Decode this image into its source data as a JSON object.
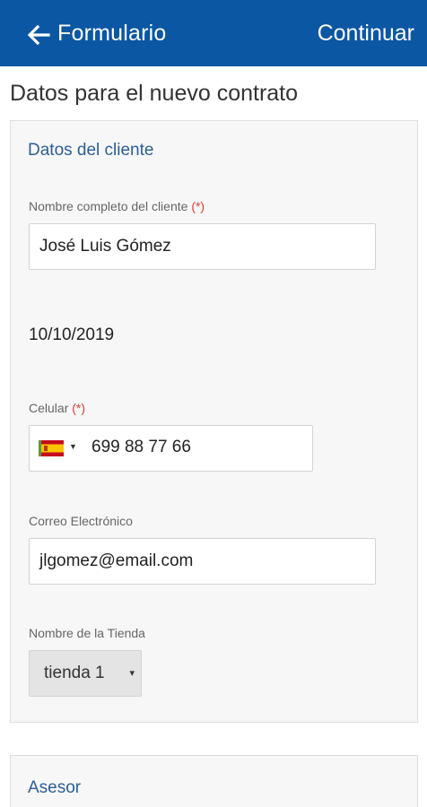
{
  "appbar": {
    "title": "Formulario",
    "continue_label": "Continuar",
    "back_icon": "arrow-left-icon",
    "background": "#0b57a4"
  },
  "page": {
    "heading": "Datos para el nuevo contrato"
  },
  "client_section": {
    "title": "Datos del cliente",
    "full_name": {
      "label": "Nombre completo del cliente",
      "required_mark": "(*)",
      "value": "José Luis Gómez"
    },
    "date": {
      "value": "10/10/2019"
    },
    "phone": {
      "label": "Celular",
      "required_mark": "(*)",
      "country_flag": "spain-flag-icon",
      "value": "699 88 77 66"
    },
    "email": {
      "label": "Correo Electrónico",
      "value": "jlgomez@email.com"
    },
    "store": {
      "label": "Nombre de la Tienda",
      "selected": "tienda 1",
      "caret": "▾"
    }
  },
  "advisor_section": {
    "title": "Asesor"
  },
  "colors": {
    "accent": "#0b57a4",
    "section_title": "#2b5f96",
    "required": "#e53935"
  }
}
